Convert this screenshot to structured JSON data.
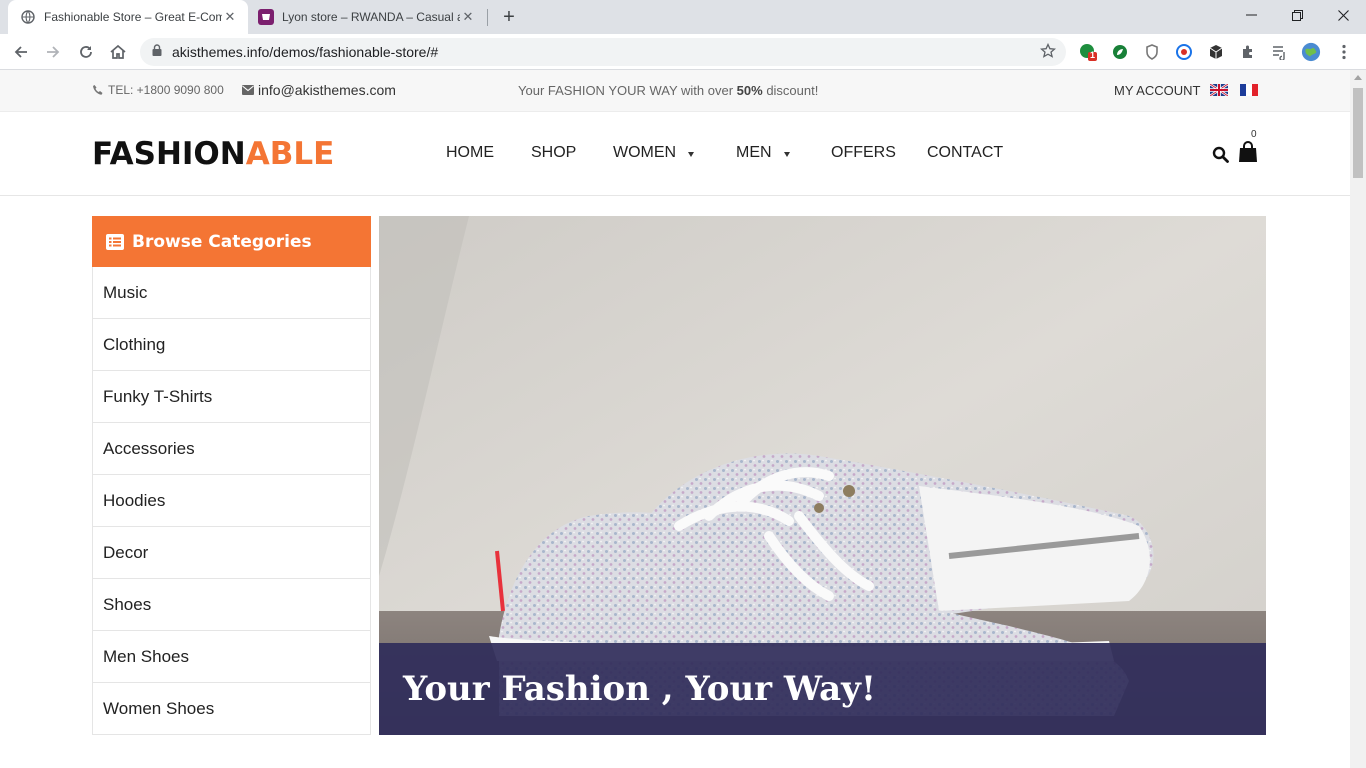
{
  "browser": {
    "tabs": [
      {
        "title": "Fashionable Store – Great E-Com",
        "active": true
      },
      {
        "title": "Lyon store – RWANDA – Casual a",
        "active": false
      }
    ],
    "url": "akisthemes.info/demos/fashionable-store/#",
    "extension_badge": "1"
  },
  "topbar": {
    "tel": "TEL: +1800 9090 800",
    "email": "info@akisthemes.com",
    "promo_prefix": "Your FASHION YOUR WAY with over ",
    "promo_bold": "50%",
    "promo_suffix": " discount!",
    "account": "MY ACCOUNT"
  },
  "header": {
    "logo_part1": "FASHION",
    "logo_part2": "ABLE",
    "menu": {
      "home": "HOME",
      "shop": "SHOP",
      "women": "WOMEN",
      "men": "MEN",
      "offers": "OFFERS",
      "contact": "CONTACT"
    },
    "cart_count": "0"
  },
  "sidebar": {
    "title": "Browse Categories",
    "categories": [
      "Music",
      "Clothing",
      "Funky T-Shirts",
      "Accessories",
      "Hoodies",
      "Decor",
      "Shoes",
      "Men Shoes",
      "Women Shoes"
    ]
  },
  "hero": {
    "caption": "Your Fashion , Your Way!"
  },
  "colors": {
    "accent": "#f47534",
    "caption_bg": "#302d5a"
  }
}
